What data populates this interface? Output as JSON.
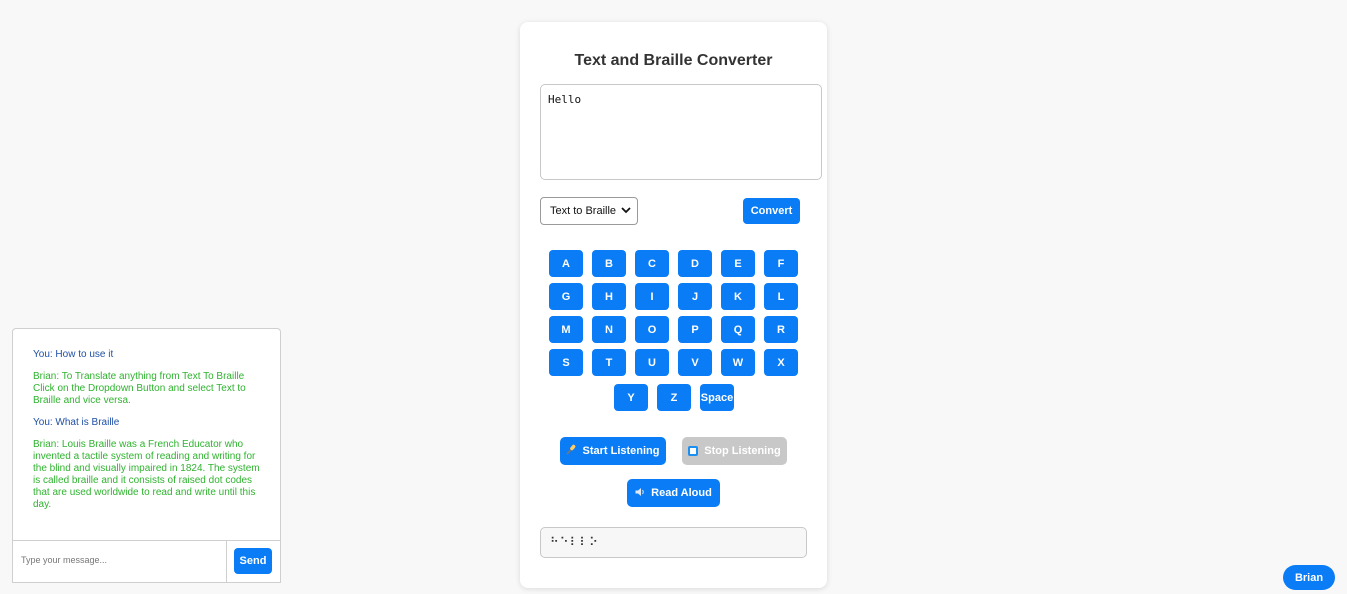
{
  "app": {
    "title": "Text and Braille Converter"
  },
  "converter": {
    "input_value": "Hello",
    "mode_selected": "Text to Braille",
    "mode_options": [
      "Text to Braille"
    ],
    "convert_label": "Convert",
    "output_value": "⠓⠑⠇⠇⠕"
  },
  "keyboard": {
    "rows": [
      [
        "A",
        "B",
        "C",
        "D",
        "E",
        "F"
      ],
      [
        "G",
        "H",
        "I",
        "J",
        "K",
        "L"
      ],
      [
        "M",
        "N",
        "O",
        "P",
        "Q",
        "R"
      ],
      [
        "S",
        "T",
        "U",
        "V",
        "W",
        "X"
      ],
      [
        "Y",
        "Z",
        "Space"
      ]
    ]
  },
  "speech": {
    "start_label": "Start Listening",
    "start_icon": "microphone-icon",
    "stop_label": "Stop Listening",
    "stop_icon": "stop-icon",
    "read_label": "Read Aloud",
    "read_icon": "speaker-icon"
  },
  "chat": {
    "messages": [
      {
        "from": "you",
        "text": "You: How to use it"
      },
      {
        "from": "bot",
        "text": "Brian: To Translate anything from Text To Braille Click on the Dropdown Button and select Text to Braille and vice versa."
      },
      {
        "from": "you",
        "text": "You: What is Braille"
      },
      {
        "from": "bot",
        "text": "Brian: Louis Braille was a French Educator who invented a tactile system of reading and writing for the blind and visually impaired in 1824. The system is called braille and it consists of raised dot codes that are used worldwide to read and write until this day."
      }
    ],
    "input_placeholder": "Type your message...",
    "send_label": "Send",
    "toggle_label": "Brian"
  },
  "colors": {
    "accent": "#0a7cf5",
    "bot_text": "#2fb32f",
    "user_text": "#1f4fa5",
    "disabled": "#c8c8c8"
  }
}
